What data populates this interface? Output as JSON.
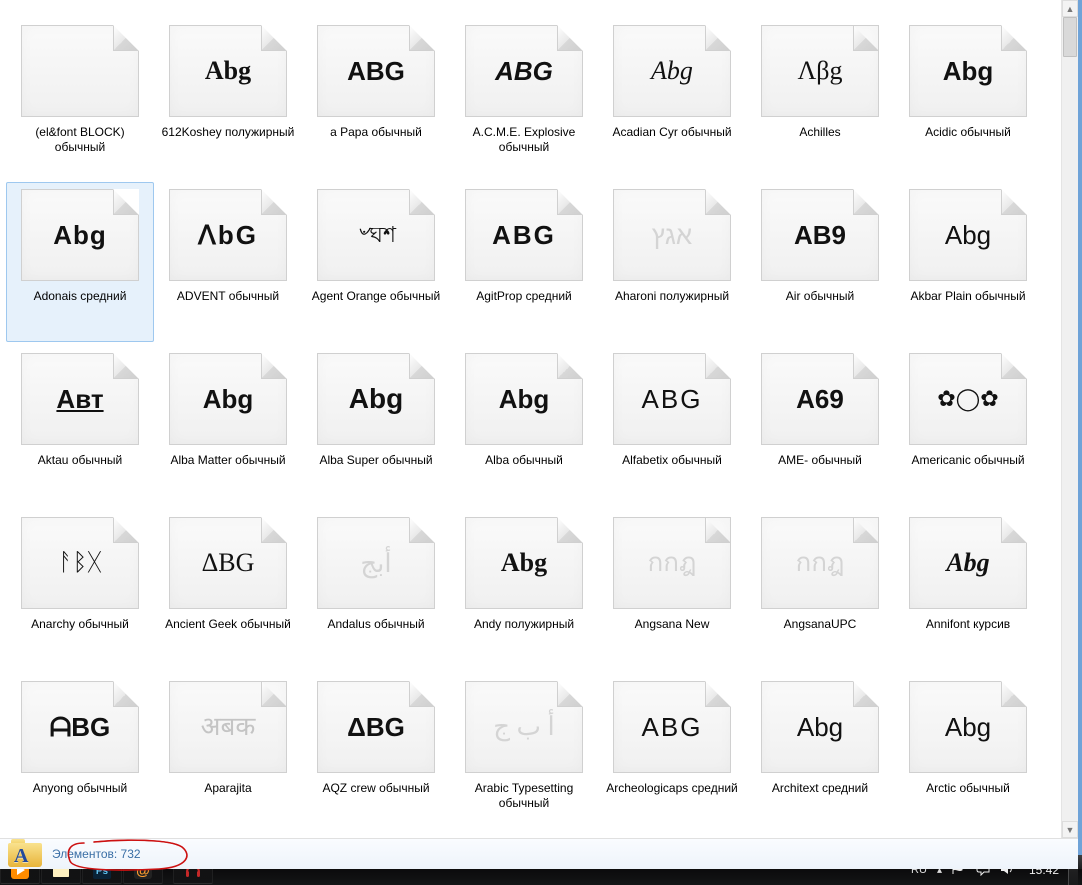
{
  "details": {
    "text": "Элементов: 732",
    "folder_letter": "A"
  },
  "taskbar": {
    "lang": "RU",
    "clock": "15:42"
  },
  "items": [
    {
      "label": "(el&font BLOCK) обычный",
      "preview": "",
      "style": "",
      "stacked": false,
      "selected": false
    },
    {
      "label": "612Koshey полужирный",
      "preview": "Abg",
      "style": "font-family:cursive;font-weight:700;",
      "stacked": false,
      "selected": false
    },
    {
      "label": "a Papa обычный",
      "preview": "ABG",
      "style": "font-weight:600;",
      "stacked": false,
      "selected": false
    },
    {
      "label": "A.C.M.E. Explosive обычный",
      "preview": "ABG",
      "style": "font-style:italic;font-weight:600;",
      "stacked": false,
      "selected": false
    },
    {
      "label": "Acadian Cyr обычный",
      "preview": "Abg",
      "style": "font-family:Georgia,serif;font-style:italic;",
      "stacked": false,
      "selected": false
    },
    {
      "label": "Achilles",
      "preview": "Λβg",
      "style": "font-family:serif;",
      "stacked": true,
      "selected": false
    },
    {
      "label": "Acidic обычный",
      "preview": "Abg",
      "style": "font-weight:600;",
      "stacked": false,
      "selected": false
    },
    {
      "label": "Adonais средний",
      "preview": "Abg",
      "style": "font-weight:800;letter-spacing:1px;",
      "stacked": false,
      "selected": true
    },
    {
      "label": "ADVENT обычный",
      "preview": "ᐱbG",
      "style": "letter-spacing:2px;font-weight:600;",
      "stacked": false,
      "selected": false
    },
    {
      "label": "Agent Orange обычный",
      "preview": "৺ঘশ",
      "style": "font-size:22px;",
      "stacked": false,
      "selected": false
    },
    {
      "label": "AgitProp средний",
      "preview": "ABG",
      "style": "font-weight:900;letter-spacing:2px;",
      "stacked": false,
      "selected": false
    },
    {
      "label": "Aharoni полужирный",
      "preview": "אגץ",
      "style": "",
      "stacked": false,
      "selected": false,
      "faint": true
    },
    {
      "label": "Air обычный",
      "preview": "AB9",
      "style": "font-weight:900;",
      "stacked": false,
      "selected": false
    },
    {
      "label": "Akbar Plain обычный",
      "preview": "Abg",
      "style": "font-weight:400;",
      "stacked": false,
      "selected": false
    },
    {
      "label": "Aktau обычный",
      "preview": "Aвт",
      "style": "font-weight:900;text-decoration:underline;",
      "stacked": false,
      "selected": false
    },
    {
      "label": "Alba Matter обычный",
      "preview": "Abg",
      "style": "font-weight:900;",
      "stacked": false,
      "selected": false
    },
    {
      "label": "Alba Super обычный",
      "preview": "Abg",
      "style": "font-weight:900;font-size:28px;",
      "stacked": false,
      "selected": false
    },
    {
      "label": "Alba обычный",
      "preview": "Abg",
      "style": "font-weight:900;",
      "stacked": false,
      "selected": false
    },
    {
      "label": "Alfabetix обычный",
      "preview": "ABG",
      "style": "letter-spacing:2px;",
      "stacked": false,
      "selected": false
    },
    {
      "label": "AME- обычный",
      "preview": "A69",
      "style": "font-weight:900;",
      "stacked": false,
      "selected": false
    },
    {
      "label": "Americanic обычный",
      "preview": "✿◯✿",
      "style": "font-size:22px;",
      "stacked": false,
      "selected": false
    },
    {
      "label": "Anarchy обычный",
      "preview": "ᚨᛒᚷ",
      "style": "font-size:24px;",
      "stacked": false,
      "selected": false
    },
    {
      "label": "Ancient Geek обычный",
      "preview": "ΔBG",
      "style": "font-family:serif;",
      "stacked": false,
      "selected": false
    },
    {
      "label": "Andalus обычный",
      "preview": "أبج",
      "style": "",
      "stacked": false,
      "selected": false,
      "faint": true
    },
    {
      "label": "Andy полужирный",
      "preview": "Abg",
      "style": "font-family:cursive;font-weight:600;",
      "stacked": false,
      "selected": false
    },
    {
      "label": "Angsana New",
      "preview": "กกฎ",
      "style": "font-family:serif;",
      "stacked": true,
      "selected": false,
      "faint": true
    },
    {
      "label": "AngsanaUPC",
      "preview": "กกฎ",
      "style": "font-family:serif;",
      "stacked": true,
      "selected": false,
      "faint": true
    },
    {
      "label": "Annifont курсив",
      "preview": "Abg",
      "style": "font-style:italic;font-family:cursive;font-weight:600;",
      "stacked": false,
      "selected": false
    },
    {
      "label": "Anyong обычный",
      "preview": "ᗩBG",
      "style": "font-weight:700;",
      "stacked": false,
      "selected": false
    },
    {
      "label": "Aparajita",
      "preview": "अबक",
      "style": "font-family:serif;",
      "stacked": true,
      "selected": false,
      "gray": true
    },
    {
      "label": "AQZ crew обычный",
      "preview": "ΔBG",
      "style": "font-weight:900;",
      "stacked": false,
      "selected": false
    },
    {
      "label": "Arabic Typesetting обычный",
      "preview": "أ ب ج",
      "style": "font-family:serif;",
      "stacked": false,
      "selected": false,
      "faint": true
    },
    {
      "label": "Archeologicaps средний",
      "preview": "ABG",
      "style": "letter-spacing:2px;",
      "stacked": false,
      "selected": false
    },
    {
      "label": "Architext средний",
      "preview": "Abg",
      "style": "font-weight:300;",
      "stacked": false,
      "selected": false
    },
    {
      "label": "Arctic обычный",
      "preview": "Abg",
      "style": "font-weight:300;",
      "stacked": false,
      "selected": false
    }
  ]
}
